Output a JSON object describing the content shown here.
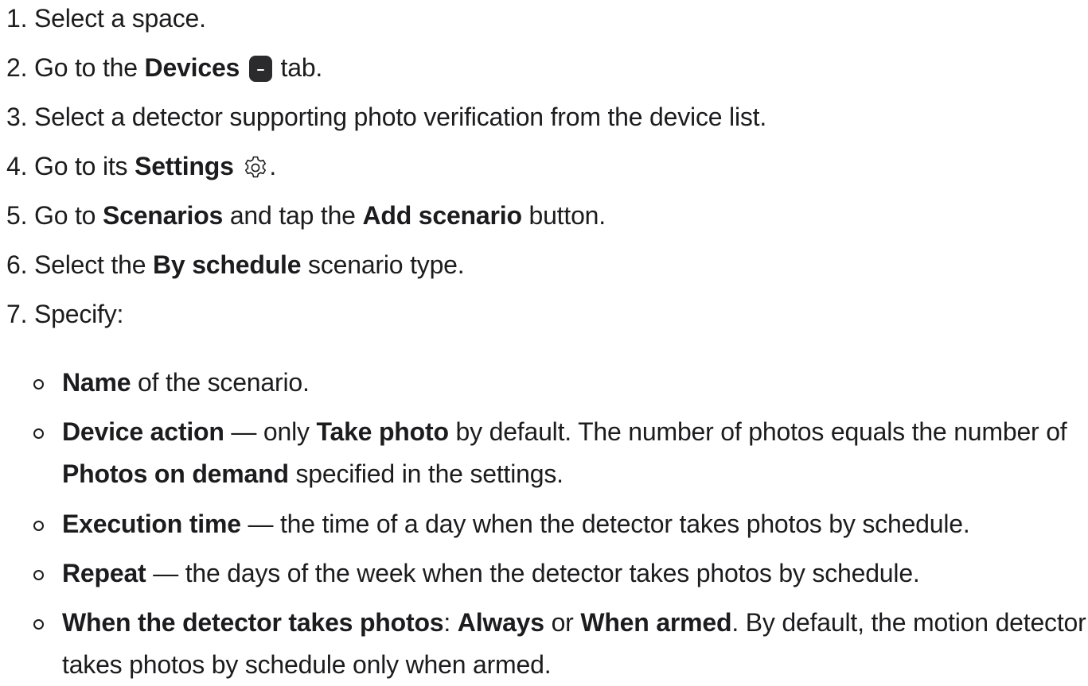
{
  "steps": [
    {
      "num": "1.",
      "t1": "Select a space."
    },
    {
      "num": "2.",
      "t1": "Go to the ",
      "b1": "Devices",
      "t2": " tab."
    },
    {
      "num": "3.",
      "t1": "Select a detector supporting photo verification from the device list."
    },
    {
      "num": "4.",
      "t1": "Go to its ",
      "b1": "Settings",
      "t2": "."
    },
    {
      "num": "5.",
      "t1": "Go to ",
      "b1": "Scenarios",
      "t2": " and tap the ",
      "b2": "Add scenario",
      "t3": " button."
    },
    {
      "num": "6.",
      "t1": "Select the ",
      "b1": "By schedule",
      "t2": " scenario type."
    },
    {
      "num": "7.",
      "t1": "Specify:"
    }
  ],
  "subitems": [
    {
      "b1": "Name",
      "t1": " of the scenario."
    },
    {
      "b1": "Device action",
      "t1": " — only ",
      "b2": "Take photo",
      "t2": " by default. The number of photos equals the number of ",
      "b3": "Photos on demand",
      "t3": " specified in the settings."
    },
    {
      "b1": "Execution time",
      "t1": " — the time of a day when the detector takes photos by schedule."
    },
    {
      "b1": "Repeat",
      "t1": " — the days of the week when the detector takes photos by schedule."
    },
    {
      "b1": "When the detector takes photos",
      "t1": ": ",
      "b2": "Always",
      "t2": " or ",
      "b3": "When armed",
      "t3": ". By default, the motion detector takes photos by schedule only when armed."
    }
  ],
  "icons": {
    "devices": "devices-tab-icon",
    "settings": "gear-icon"
  }
}
